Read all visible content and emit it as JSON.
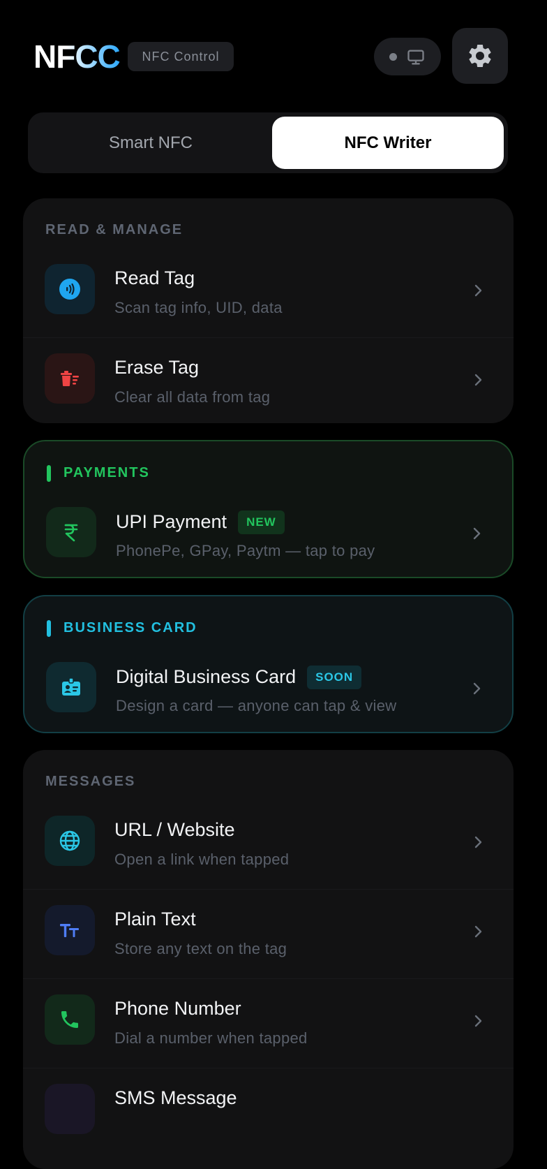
{
  "header": {
    "logo": "NFCC",
    "badge": "NFC Control"
  },
  "tabs": [
    {
      "label": "Smart NFC",
      "active": false
    },
    {
      "label": "NFC Writer",
      "active": true
    }
  ],
  "sections": {
    "read_manage": {
      "title": "READ & MANAGE",
      "items": [
        {
          "title": "Read Tag",
          "subtitle": "Scan tag info, UID, data",
          "icon": "nfc-signal-icon"
        },
        {
          "title": "Erase Tag",
          "subtitle": "Clear all data from tag",
          "icon": "erase-icon"
        }
      ]
    },
    "payments": {
      "title": "PAYMENTS",
      "items": [
        {
          "title": "UPI Payment",
          "badge": "NEW",
          "subtitle": "PhonePe, GPay, Paytm — tap to pay",
          "icon": "rupee-icon"
        }
      ]
    },
    "business_card": {
      "title": "BUSINESS CARD",
      "items": [
        {
          "title": "Digital Business Card",
          "badge": "SOON",
          "subtitle": "Design a card — anyone can tap & view",
          "icon": "id-badge-icon"
        }
      ]
    },
    "messages": {
      "title": "MESSAGES",
      "items": [
        {
          "title": "URL / Website",
          "subtitle": "Open a link when tapped",
          "icon": "globe-icon"
        },
        {
          "title": "Plain Text",
          "subtitle": "Store any text on the tag",
          "icon": "text-icon"
        },
        {
          "title": "Phone Number",
          "subtitle": "Dial a number when tapped",
          "icon": "phone-icon"
        },
        {
          "title": "SMS Message",
          "subtitle": "",
          "icon": "sms-icon"
        }
      ]
    }
  },
  "colors": {
    "background": "#000000",
    "card": "#121213",
    "accent_blue": "#2aa8ff",
    "green": "#22c55e",
    "teal": "#22c0e0"
  }
}
